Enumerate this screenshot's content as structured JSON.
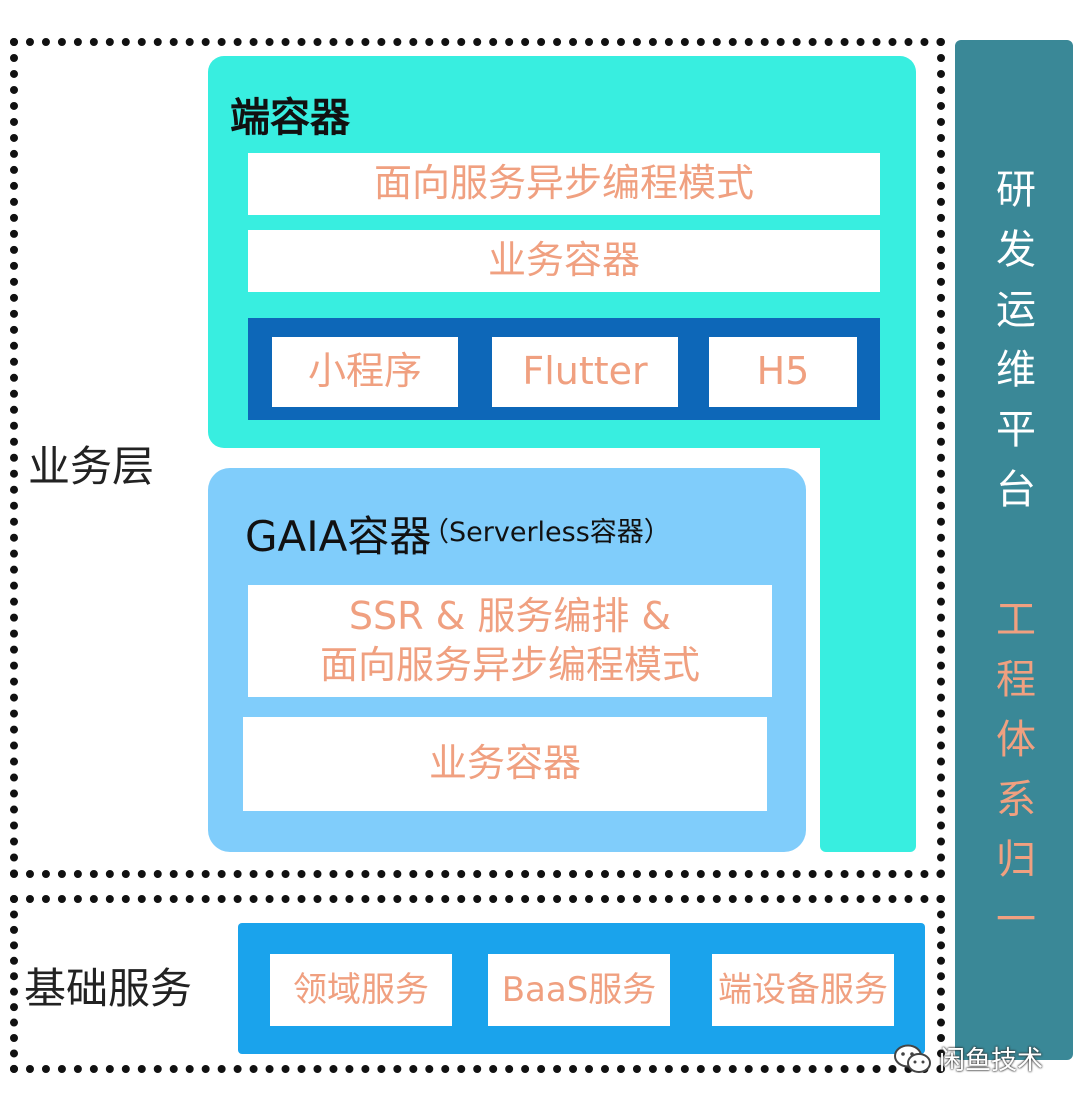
{
  "layers": {
    "business": {
      "label": "业务层"
    },
    "foundation": {
      "label": "基础服务"
    }
  },
  "end_container": {
    "title": "端容器",
    "rows": [
      "面向服务异步编程模式",
      "业务容器"
    ],
    "runtimes": [
      "小程序",
      "Flutter",
      "H5"
    ]
  },
  "gaia_container": {
    "title": "GAIA容器",
    "subtitle": "（Serverless容器）",
    "box1_line1": "SSR & 服务编排 &",
    "box1_line2": "面向服务异步编程模式",
    "box2": "业务容器"
  },
  "foundation_services": [
    "领域服务",
    "BaaS服务",
    "端设备服务"
  ],
  "side_bar": {
    "top": "研发运维平台",
    "bottom": "工程体系归一"
  },
  "watermark": "闲鱼技术",
  "colors": {
    "cyan": "#38eee0",
    "light_blue": "#80cdfb",
    "navy": "#0d67b8",
    "bright_blue": "#1aa3ec",
    "teal": "#3a8897",
    "salmon_text": "#f0a080"
  }
}
